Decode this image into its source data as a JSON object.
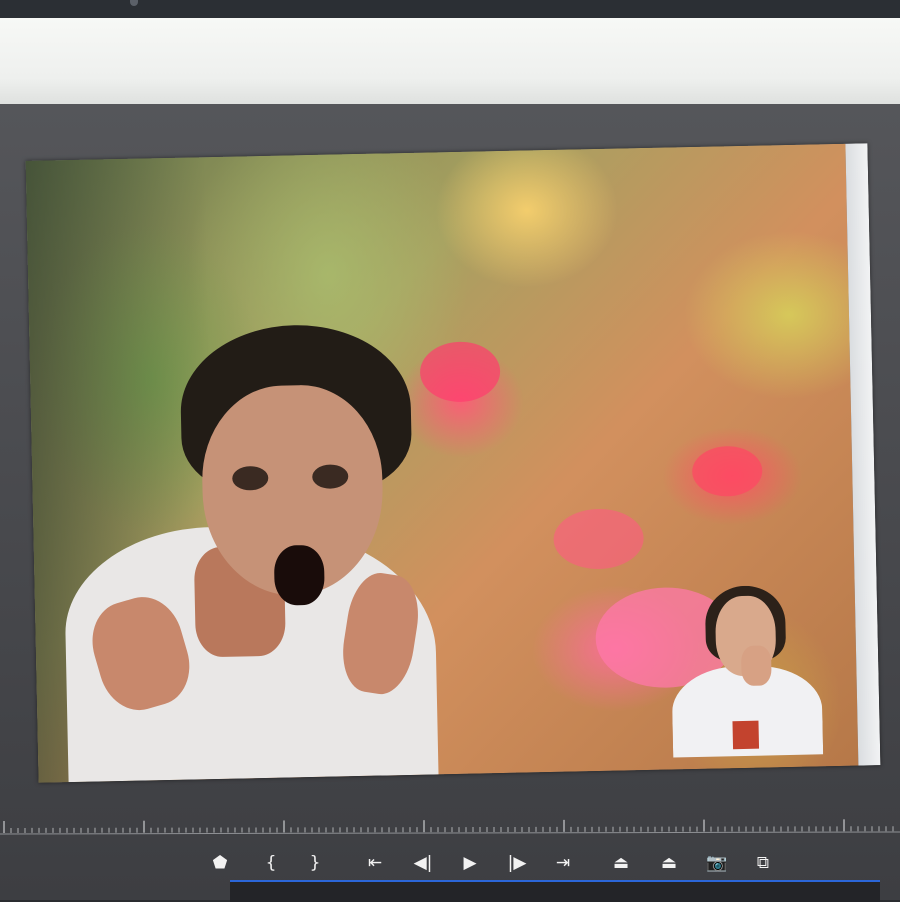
{
  "window": {
    "title": ""
  },
  "monitor": {
    "content": "program-monitor-video-frame"
  },
  "controls": [
    {
      "name": "add-marker-button",
      "icon": "marker-icon",
      "glyph": "⬟"
    },
    {
      "name": "mark-in-button",
      "icon": "mark-in-icon",
      "glyph": "{"
    },
    {
      "name": "mark-out-button",
      "icon": "mark-out-icon",
      "glyph": "}"
    },
    {
      "name": "go-to-in-button",
      "icon": "go-to-in-icon",
      "glyph": "⇤"
    },
    {
      "name": "step-back-button",
      "icon": "step-back-icon",
      "glyph": "◀|"
    },
    {
      "name": "play-button",
      "icon": "play-icon",
      "glyph": "▶"
    },
    {
      "name": "step-forward-button",
      "icon": "step-forward-icon",
      "glyph": "|▶"
    },
    {
      "name": "go-to-out-button",
      "icon": "go-to-out-icon",
      "glyph": "⇥"
    },
    {
      "name": "lift-button",
      "icon": "lift-icon",
      "glyph": "⏏"
    },
    {
      "name": "extract-button",
      "icon": "extract-icon",
      "glyph": "⏏"
    },
    {
      "name": "export-frame-button",
      "icon": "camera-icon",
      "glyph": "📷"
    },
    {
      "name": "compare-view-button",
      "icon": "compare-view-icon",
      "glyph": "⧉"
    }
  ],
  "colors": {
    "panel": "#4a4b4f",
    "timeline_accent": "#2b66d9"
  }
}
